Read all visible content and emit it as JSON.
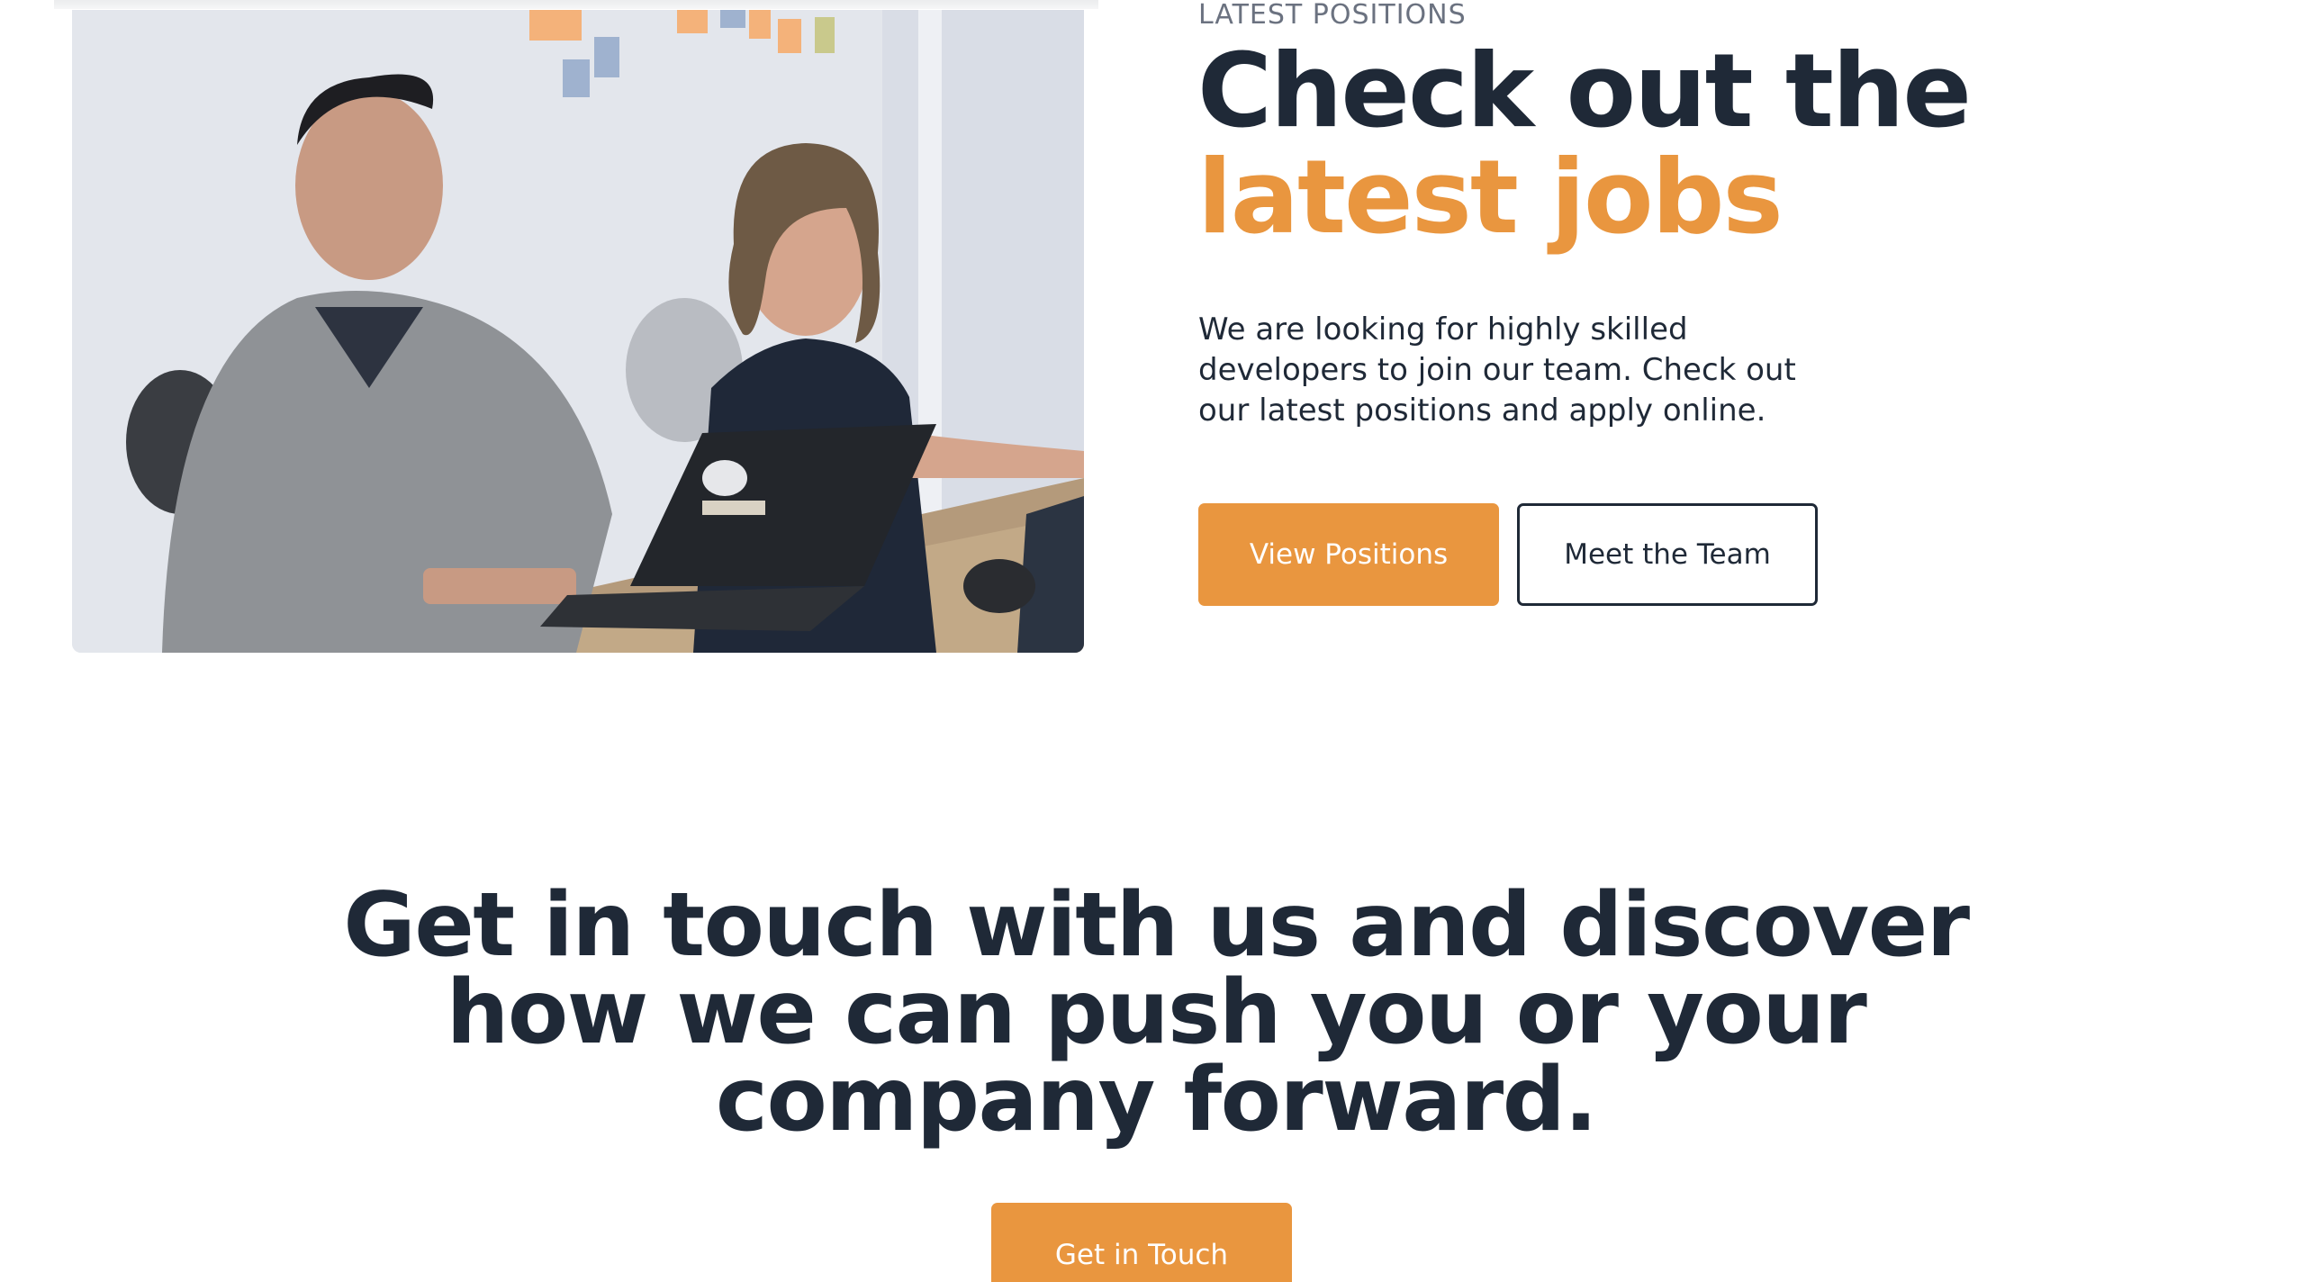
{
  "positions": {
    "eyebrow": "LATEST POSITIONS",
    "title_line1": "Check out the",
    "title_line2": "latest jobs",
    "description": "We are looking for highly skilled developers to join our team. Check out our latest positions and apply online.",
    "primary_button": "View Positions",
    "secondary_button": "Meet the Team"
  },
  "cta": {
    "title": "Get in touch with us and discover how we can push you or your company forward.",
    "button": "Get in Touch"
  },
  "colors": {
    "accent": "#e9963f",
    "text_dark": "#1f2937",
    "eyebrow": "#6b7280",
    "background": "#ffffff"
  },
  "icons": {
    "team_photo": "office-team-photo"
  }
}
